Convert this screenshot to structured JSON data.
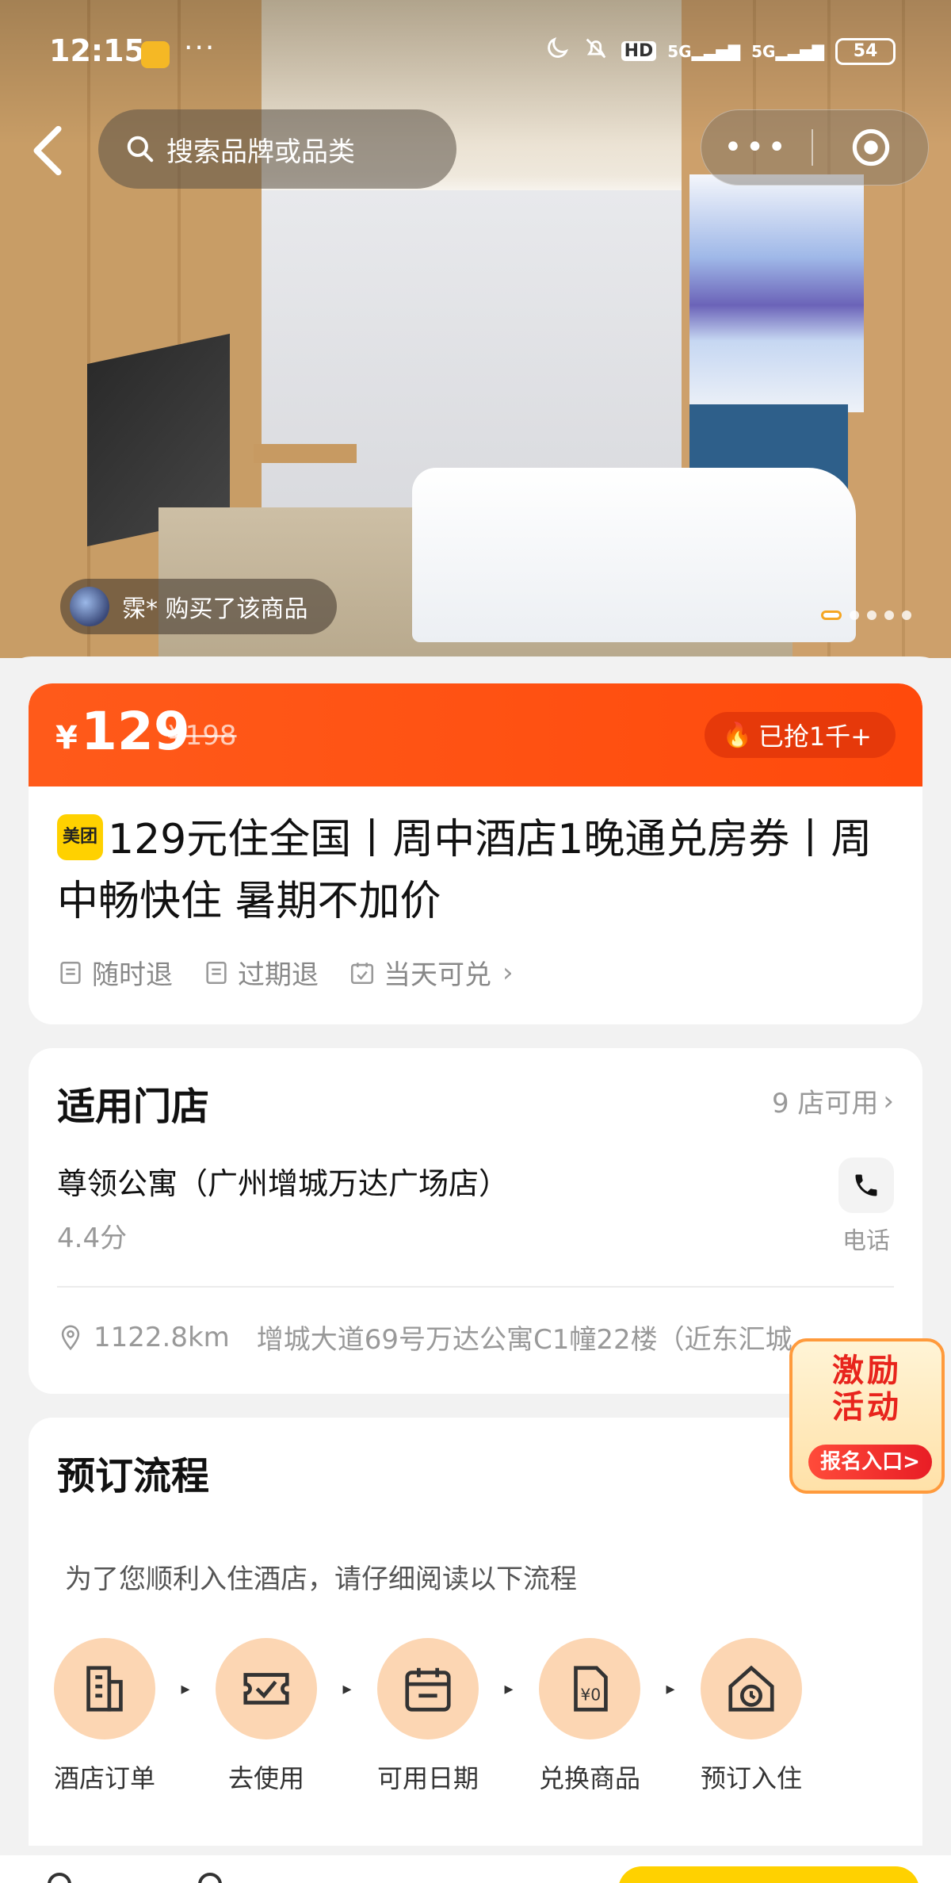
{
  "status_bar": {
    "time": "12:15",
    "more": "···",
    "hd": "HD",
    "net1": "5G",
    "net2": "5G",
    "battery": "54"
  },
  "nav": {
    "search_placeholder": "搜索品牌或品类",
    "capsule_more": "•••"
  },
  "hero": {
    "buyer_text": "霂* 购买了该商品",
    "image_count": 5,
    "active_image": 1
  },
  "price": {
    "currency": "¥",
    "current": "129",
    "original": "¥198",
    "sold_flame": "🔥",
    "sold": "已抢1千+"
  },
  "product": {
    "brand_badge": "美团",
    "title": "129元住全国丨周中酒店1晚通兑房券丨周中畅快住 暑期不加价",
    "tags": [
      "随时退",
      "过期退",
      "当天可兑"
    ]
  },
  "stores": {
    "heading": "适用门店",
    "count": "9 店可用",
    "name": "尊领公寓（广州增城万达广场店）",
    "score": "4.4分",
    "phone_label": "电话",
    "distance": "1122.8km",
    "address": "增城大道69号万达公寓C1幢22楼（近东汇城"
  },
  "promo": {
    "line1": "激励",
    "line2": "活动",
    "button": "报名入口>"
  },
  "booking": {
    "heading": "预订流程",
    "tip": "为了您顺利入住酒店，请仔细阅读以下流程",
    "steps": [
      "酒店订单",
      "去使用",
      "可用日期",
      "兑换商品",
      "预订入住"
    ]
  },
  "colors": {
    "accent": "#ff4a0c",
    "badge": "#ffd100",
    "step_circle": "#fcd6b3"
  }
}
